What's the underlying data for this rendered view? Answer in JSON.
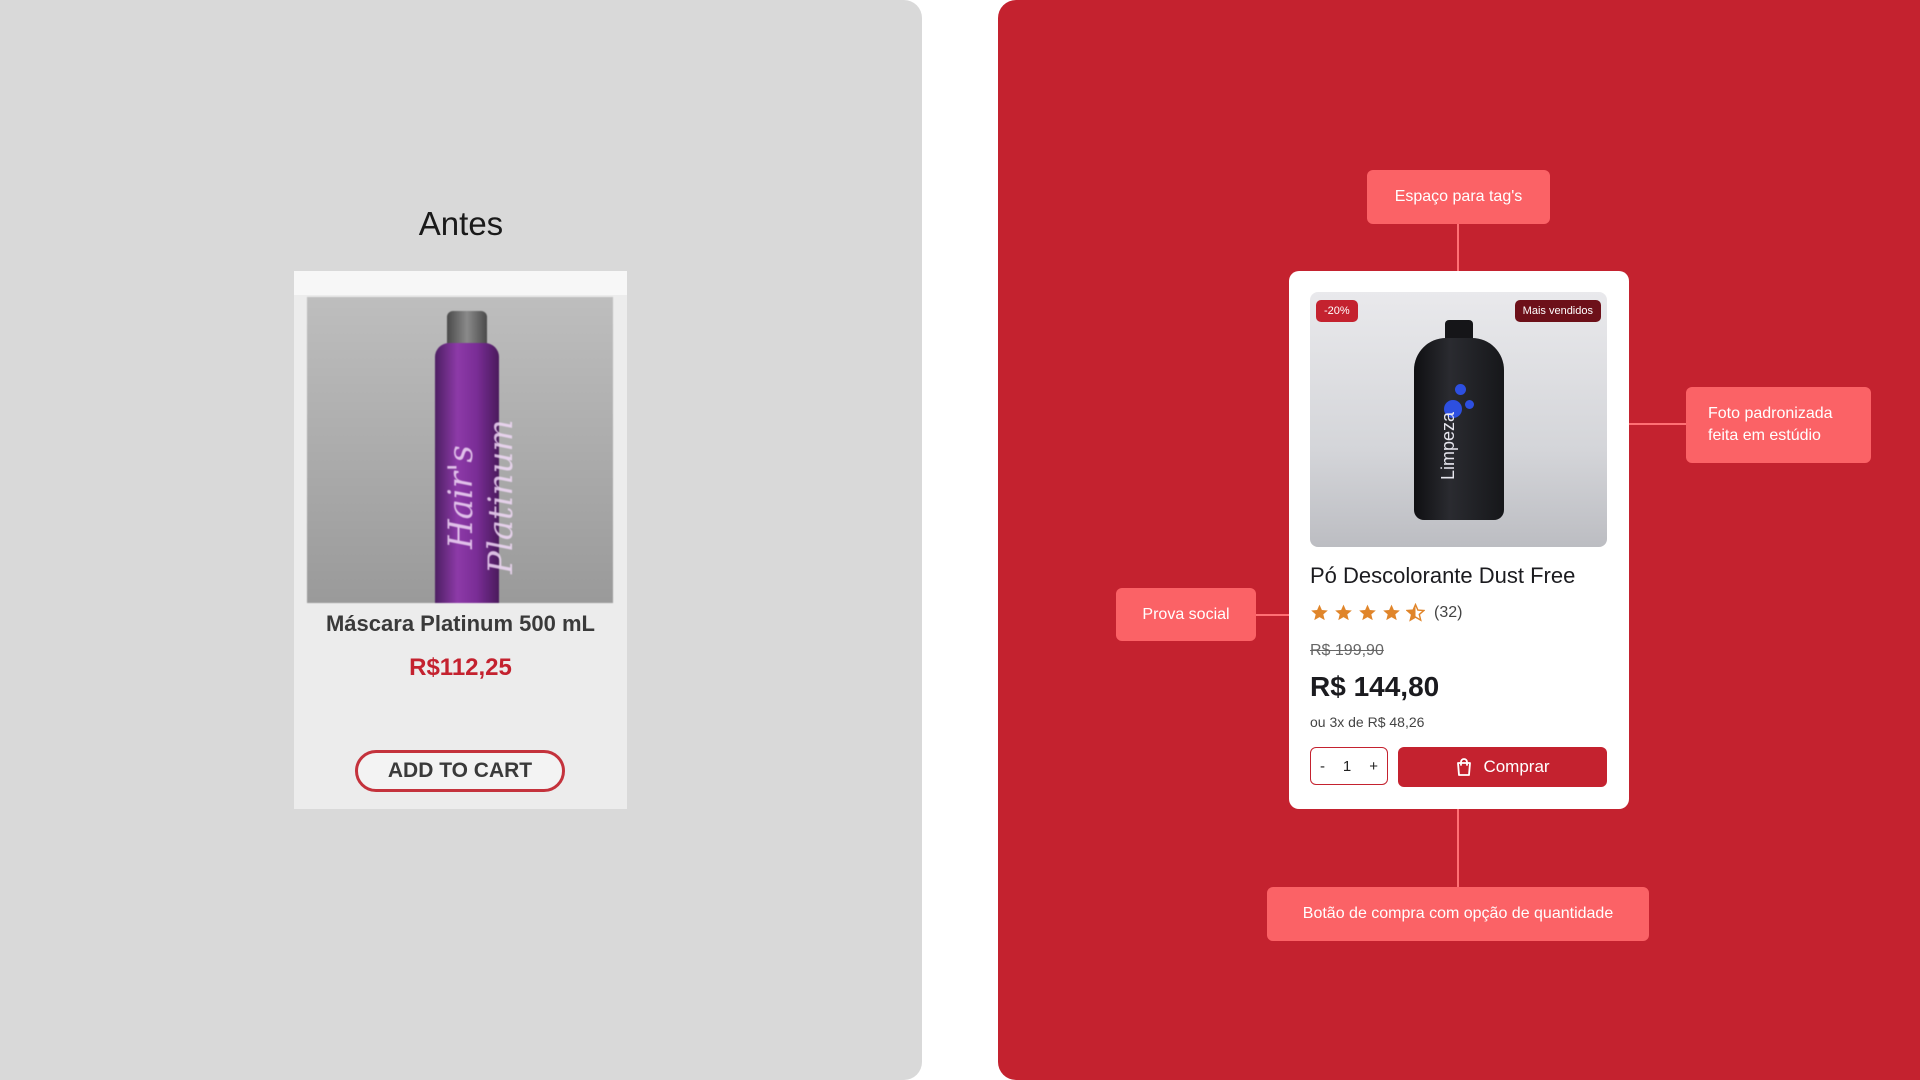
{
  "before": {
    "title": "Antes",
    "product_name": "Máscara Platinum 500 mL",
    "price": "R$112,25",
    "add_to_cart": "ADD TO CART",
    "photo_label": "Hair's Platinum"
  },
  "after": {
    "badge_discount": "-20%",
    "badge_best_seller": "Mais vendidos",
    "bottle_label": "Limpeza",
    "product_name": "Pó Descolorante Dust Free",
    "rating": 4.5,
    "rating_count": "(32)",
    "old_price": "R$ 199,90",
    "price": "R$ 144,80",
    "installments": "ou 3x de R$ 48,26",
    "qty_minus": "-",
    "qty_value": "1",
    "qty_plus": "+",
    "buy_label": "Comprar"
  },
  "callouts": {
    "tags": "Espaço para tag's",
    "photo": "Foto padronizada feita em estúdio",
    "social": "Prova social",
    "buy": "Botão de compra com opção de quantidade"
  },
  "colors": {
    "brand_red": "#c4222f",
    "callout": "#fb6266",
    "star": "#e0852a"
  }
}
